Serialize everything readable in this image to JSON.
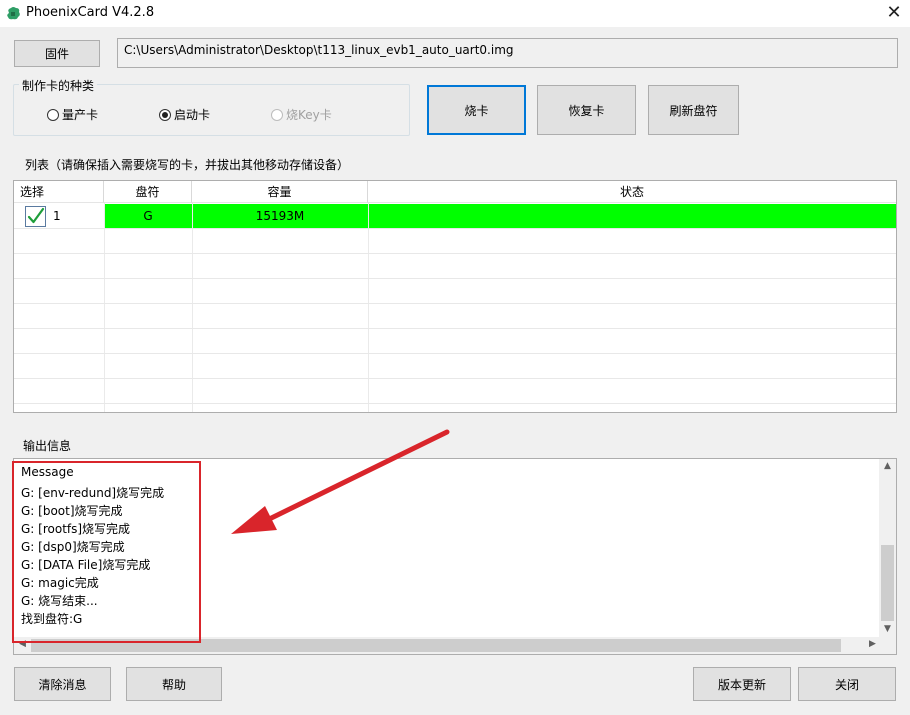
{
  "window": {
    "title": "PhoenixCard V4.2.8"
  },
  "firmware": {
    "button_label": "固件",
    "path": "C:\\Users\\Administrator\\Desktop\\t113_linux_evb1_auto_uart0.img"
  },
  "card_type": {
    "group_label": "制作卡的种类",
    "options": [
      {
        "label": "量产卡",
        "selected": false,
        "enabled": true
      },
      {
        "label": "启动卡",
        "selected": true,
        "enabled": true
      },
      {
        "label": "烧Key卡",
        "selected": false,
        "enabled": false
      }
    ]
  },
  "actions": {
    "burn": "烧卡",
    "restore": "恢复卡",
    "refresh": "刷新盘符"
  },
  "list": {
    "label": "列表（请确保插入需要烧写的卡，并拔出其他移动存储设备）",
    "columns": [
      "选择",
      "盘符",
      "容量",
      "状态"
    ],
    "rows": [
      {
        "index": "1",
        "checked": true,
        "drive": "G",
        "capacity": "15193M",
        "status": "",
        "highlight_color": "#00ff00"
      }
    ]
  },
  "output": {
    "label": "输出信息",
    "header": "Message",
    "lines": [
      "G: [env-redund]烧写完成",
      "G: [boot]烧写完成",
      "G: [rootfs]烧写完成",
      "G: [dsp0]烧写完成",
      "G: [DATA File]烧写完成",
      "G: magic完成",
      "G: 烧写结束...",
      "找到盘符:G"
    ]
  },
  "footer": {
    "clear": "清除消息",
    "help": "帮助",
    "update": "版本更新",
    "close": "关闭"
  },
  "colors": {
    "annotation_red": "#d9252b",
    "row_highlight": "#00ff00",
    "accent": "#0078d7"
  }
}
